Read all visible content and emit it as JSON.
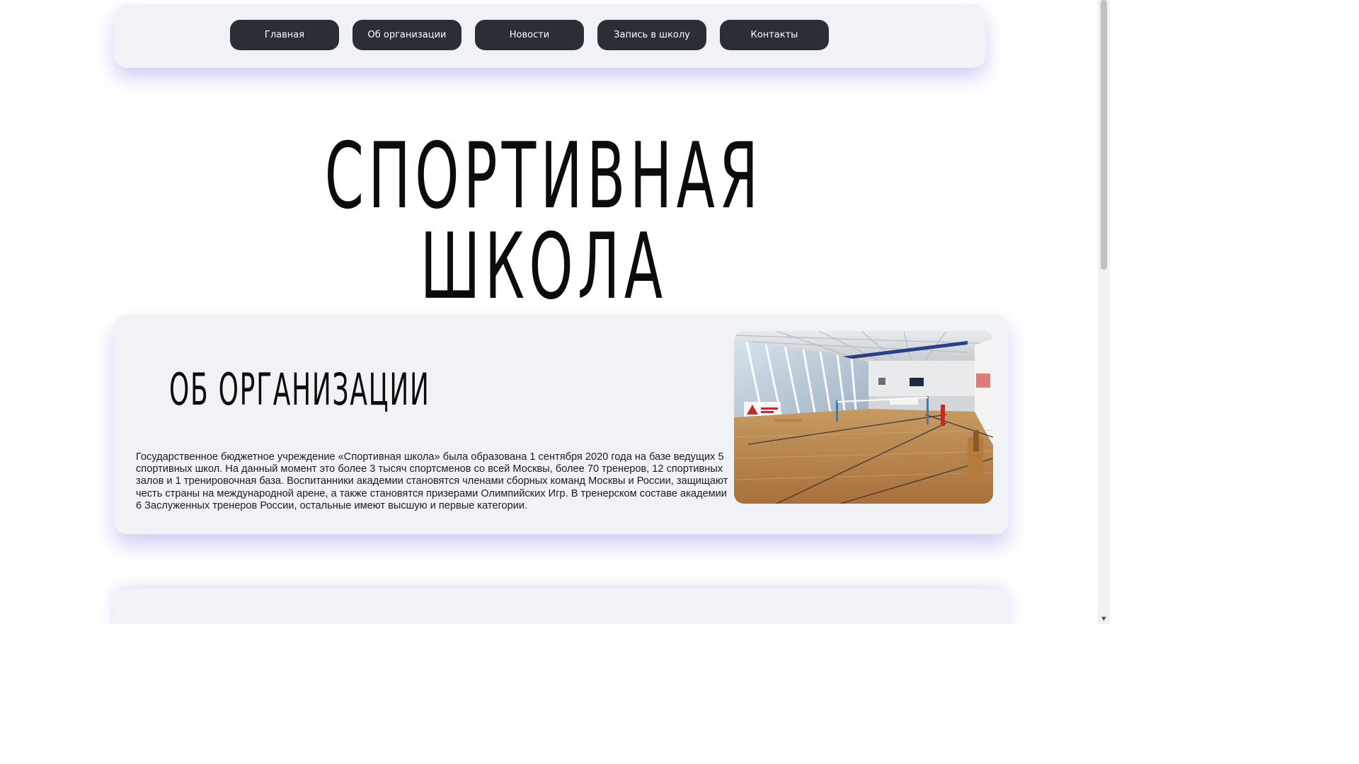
{
  "nav": {
    "items": [
      {
        "label": "Главная"
      },
      {
        "label": "Об организации"
      },
      {
        "label": "Новости"
      },
      {
        "label": "Запись в школу"
      },
      {
        "label": "Контакты"
      }
    ]
  },
  "hero": {
    "title": "СПОРТИВНАЯ ШКОЛА"
  },
  "about": {
    "title": "ОБ ОРГАНИЗАЦИИ",
    "text": "Государственное бюджетное учреждение «Спортивная школа» была образована 1 сентября 2020 года на базе ведущих 5 спортивных школ. На данный момент это более 3 тысяч спортсменов со всей Москвы, более 70 тренеров, 12 спортивных залов и 1 тренировочная база. Воспитанники академии становятся членами сборных команд Москвы и России, защищают честь страны на международной арене, а также становятся призерами Олимпийских Игр. В тренерском составе академии 6 Заслуженных тренеров России, остальные имеют высшую и первые категории.",
    "photo": {
      "alt_icon": "sports-hall-photo",
      "wall_sign": "МОСКОВСКИЙ СПОРТ"
    }
  },
  "colors": {
    "nav_button": "#2b2e36",
    "card_bg": "#f1f2f5",
    "shadow": "#aaaaeb"
  },
  "scrollbar": {
    "down_arrow_icon": "▼"
  }
}
